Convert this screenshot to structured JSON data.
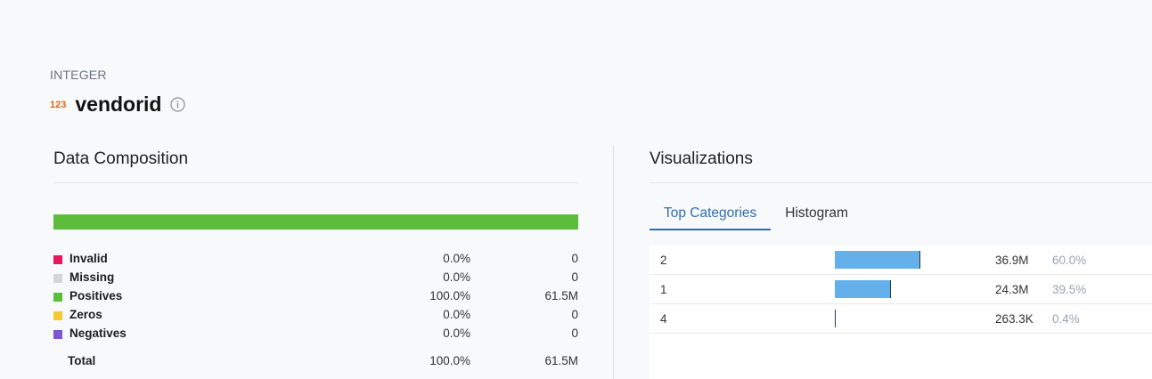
{
  "header": {
    "type_label": "INTEGER",
    "type_icon_text": "123",
    "column_name": "vendorid"
  },
  "data_composition": {
    "title": "Data Composition",
    "segments": [
      {
        "name": "Invalid",
        "fraction": 0.0,
        "color": "#e8175d"
      },
      {
        "name": "Missing",
        "fraction": 0.0,
        "color": "#d6d6d6"
      },
      {
        "name": "Positives",
        "fraction": 1.0,
        "color": "#5cbd3b"
      },
      {
        "name": "Zeros",
        "fraction": 0.0,
        "color": "#f5c933"
      },
      {
        "name": "Negatives",
        "fraction": 0.0,
        "color": "#7b55d6"
      }
    ],
    "rows": [
      {
        "label": "Invalid",
        "pct": "0.0%",
        "count": "0",
        "color": "#e8175d"
      },
      {
        "label": "Missing",
        "pct": "0.0%",
        "count": "0",
        "color": "#d6d6d6"
      },
      {
        "label": "Positives",
        "pct": "100.0%",
        "count": "61.5M",
        "color": "#5cbd3b"
      },
      {
        "label": "Zeros",
        "pct": "0.0%",
        "count": "0",
        "color": "#f5c933"
      },
      {
        "label": "Negatives",
        "pct": "0.0%",
        "count": "0",
        "color": "#7b55d6"
      }
    ],
    "total": {
      "label": "Total",
      "pct": "100.0%",
      "count": "61.5M"
    }
  },
  "visualizations": {
    "title": "Visualizations",
    "tabs": [
      {
        "label": "Top Categories",
        "active": true
      },
      {
        "label": "Histogram",
        "active": false
      }
    ],
    "top_categories": [
      {
        "name": "2",
        "fraction": 0.6,
        "count": "36.9M",
        "pct": "60.0%"
      },
      {
        "name": "1",
        "fraction": 0.395,
        "count": "24.3M",
        "pct": "39.5%"
      },
      {
        "name": "4",
        "fraction": 0.004,
        "count": "263.3K",
        "pct": "0.4%"
      }
    ],
    "bar_color": "#64b0ea"
  },
  "icons": {
    "type_icon": "integer-type-icon",
    "info_icon": "info-icon"
  }
}
